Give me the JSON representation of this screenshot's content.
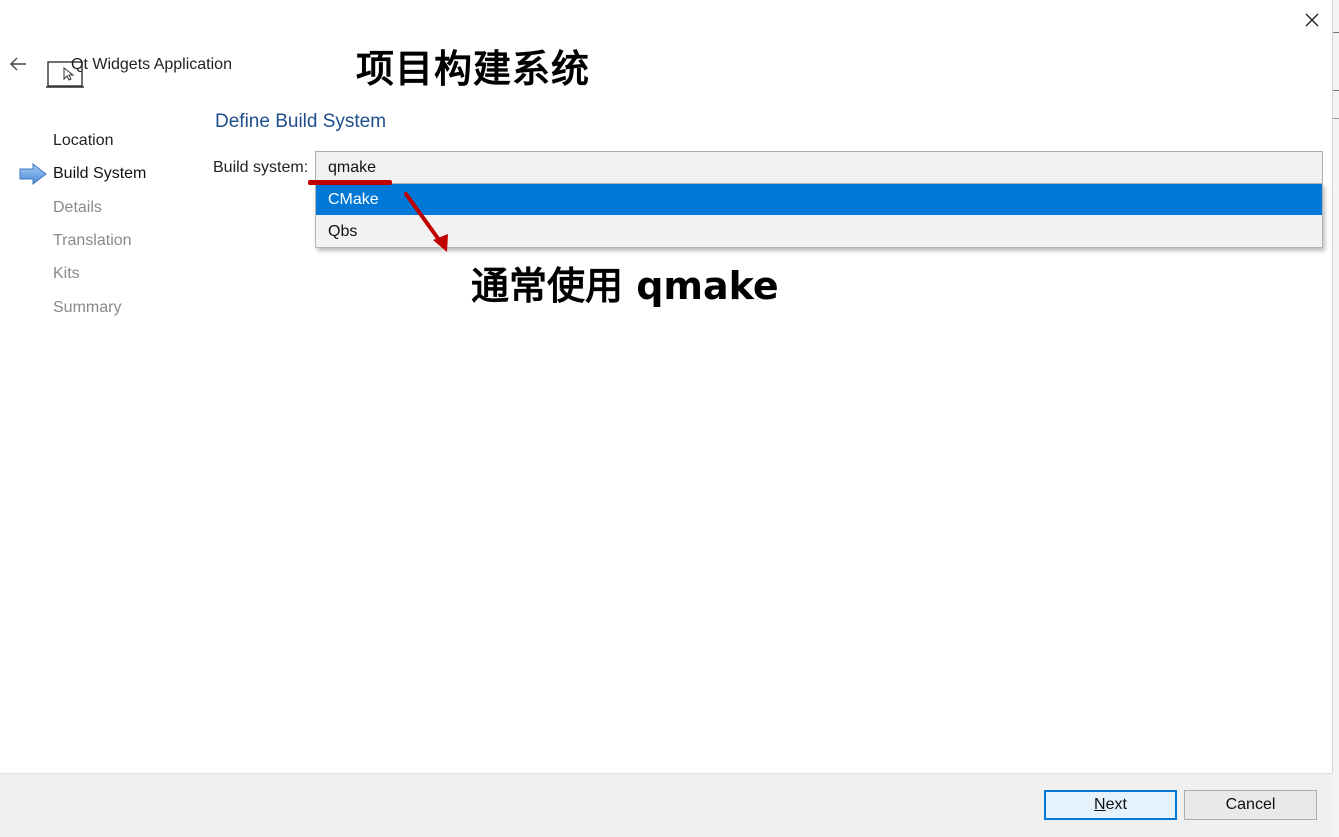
{
  "window": {
    "title": "Qt Widgets Application",
    "close_icon": "close-icon",
    "back_icon": "back-arrow-icon",
    "app_icon": "widgets-application-icon"
  },
  "annotations": {
    "title": "项目构建系统",
    "note": "通常使用 qmake",
    "underline_color": "#c00000",
    "arrow_color": "#c00000"
  },
  "steps": {
    "current_icon": "current-step-arrow-icon",
    "items": [
      {
        "label": "Location",
        "state": "done"
      },
      {
        "label": "Build System",
        "state": "current"
      },
      {
        "label": "Details",
        "state": "pending"
      },
      {
        "label": "Translation",
        "state": "pending"
      },
      {
        "label": "Kits",
        "state": "pending"
      },
      {
        "label": "Summary",
        "state": "pending"
      }
    ]
  },
  "page": {
    "heading": "Define Build System",
    "build_system_label": "Build system:",
    "build_system_value": "qmake",
    "options": [
      {
        "label": "CMake",
        "highlighted": true
      },
      {
        "label": "Qbs",
        "highlighted": false
      }
    ],
    "highlight_color": "#0078d7",
    "heading_color": "#1f4e8c"
  },
  "footer": {
    "next_mnemonic": "N",
    "next_rest": "ext",
    "cancel_label": "Cancel"
  }
}
